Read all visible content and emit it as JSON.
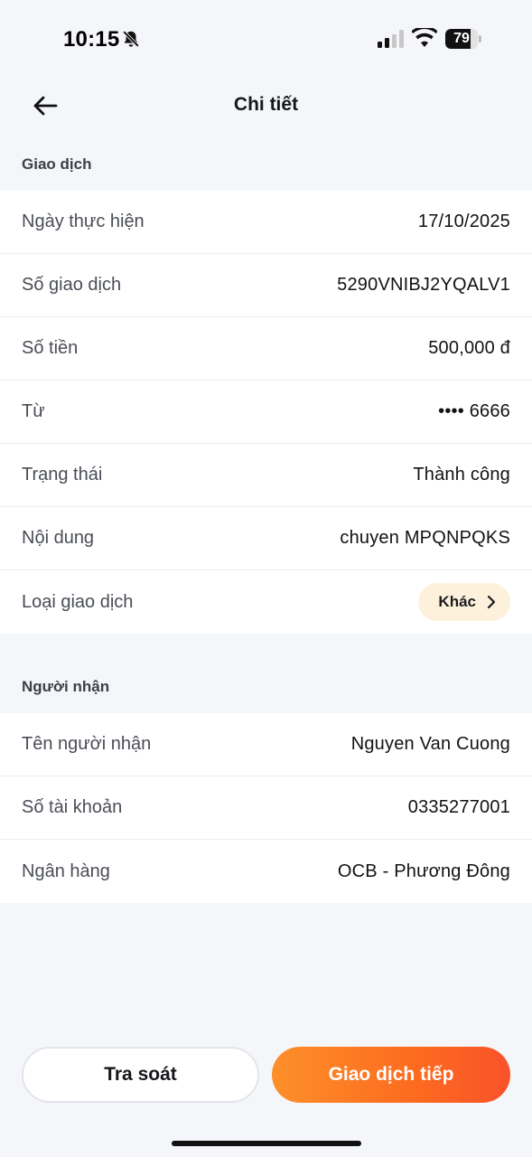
{
  "status_bar": {
    "time": "10:15",
    "battery": "79",
    "battery_level": 0.79,
    "icons": [
      "bell-muted-icon",
      "cellular-signal-icon",
      "wifi-icon",
      "battery-icon"
    ]
  },
  "header": {
    "title": "Chi tiết",
    "back_icon": "arrow-left-icon"
  },
  "transaction_section": {
    "title": "Giao dịch",
    "rows": [
      {
        "label": "Ngày thực hiện",
        "value": "17/10/2025"
      },
      {
        "label": "Số giao dịch",
        "value": "5290VNIBJ2YQALV1"
      },
      {
        "label": "Số tiền",
        "value": "500,000 đ"
      },
      {
        "label": "Từ",
        "value": "•••• 6666"
      },
      {
        "label": "Trạng thái",
        "value": "Thành công"
      },
      {
        "label": "Nội dung",
        "value": "chuyen MPQNPQKS"
      },
      {
        "label": "Loại giao dịch",
        "chip": "Khác",
        "chip_icon": "chevron-right-icon"
      }
    ]
  },
  "recipient_section": {
    "title": "Người nhận",
    "rows": [
      {
        "label": "Tên người nhận",
        "value": "Nguyen Van Cuong"
      },
      {
        "label": "Số tài khoản",
        "value": "0335277001"
      },
      {
        "label": "Ngân hàng",
        "value": "OCB - Phương Đông"
      }
    ]
  },
  "footer": {
    "secondary_label": "Tra soát",
    "primary_label": "Giao dịch tiếp"
  },
  "colors": {
    "background": "#f5f6f9",
    "primary_gradient_start": "#fd8f2a",
    "primary_gradient_end": "#f9522a",
    "chip_background": "#fdf1dc"
  }
}
